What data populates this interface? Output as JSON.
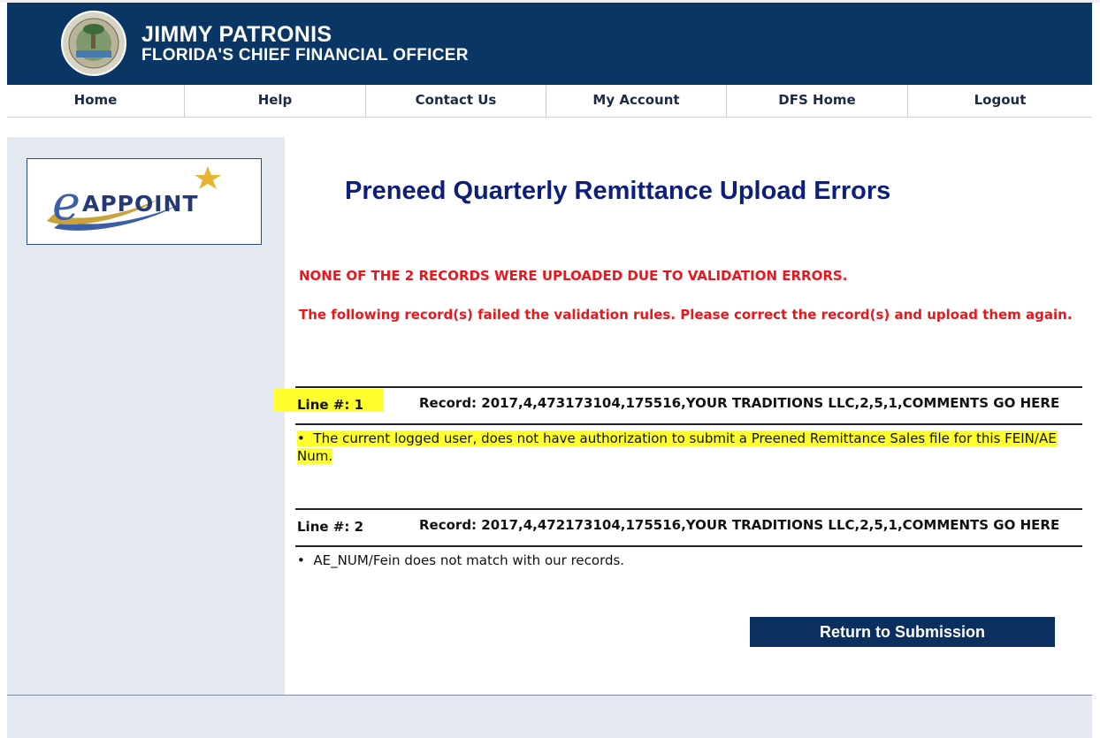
{
  "header": {
    "name": "JIMMY PATRONIS",
    "subtitle": "FLORIDA'S CHIEF FINANCIAL OFFICER",
    "seal_icon": "state-seal-icon",
    "brand_color": "#0a3666"
  },
  "nav": {
    "items": [
      {
        "label": "Home"
      },
      {
        "label": "Help"
      },
      {
        "label": "Contact Us"
      },
      {
        "label": "My Account"
      },
      {
        "label": "DFS Home"
      },
      {
        "label": "Logout"
      }
    ]
  },
  "sidebar": {
    "logo_text": "APPOINT"
  },
  "main": {
    "title": "Preneed Quarterly Remittance Upload Errors",
    "error_summary": "NONE OF THE 2 RECORDS WERE UPLOADED DUE TO VALIDATION ERRORS.",
    "error_detail": "The following record(s) failed the validation rules. Please correct the record(s) and upload them again.",
    "error_color": "#e8171d",
    "records": [
      {
        "line": "Line #: 1",
        "record": "Record: 2017,4,473173104,175516,YOUR TRADITIONS LLC,2,5,1,COMMENTS GO HERE",
        "message": "The current logged user, does not have authorization to submit a Preened Remittance Sales file for this FEIN/AE Num.",
        "highlighted": true
      },
      {
        "line": "Line #: 2",
        "record": "Record: 2017,4,472173104,175516,YOUR TRADITIONS LLC,2,5,1,COMMENTS GO HERE",
        "message": "AE_NUM/Fein does not match with our records.",
        "highlighted": false
      }
    ],
    "bullet": "•",
    "return_button": "Return to Submission"
  }
}
